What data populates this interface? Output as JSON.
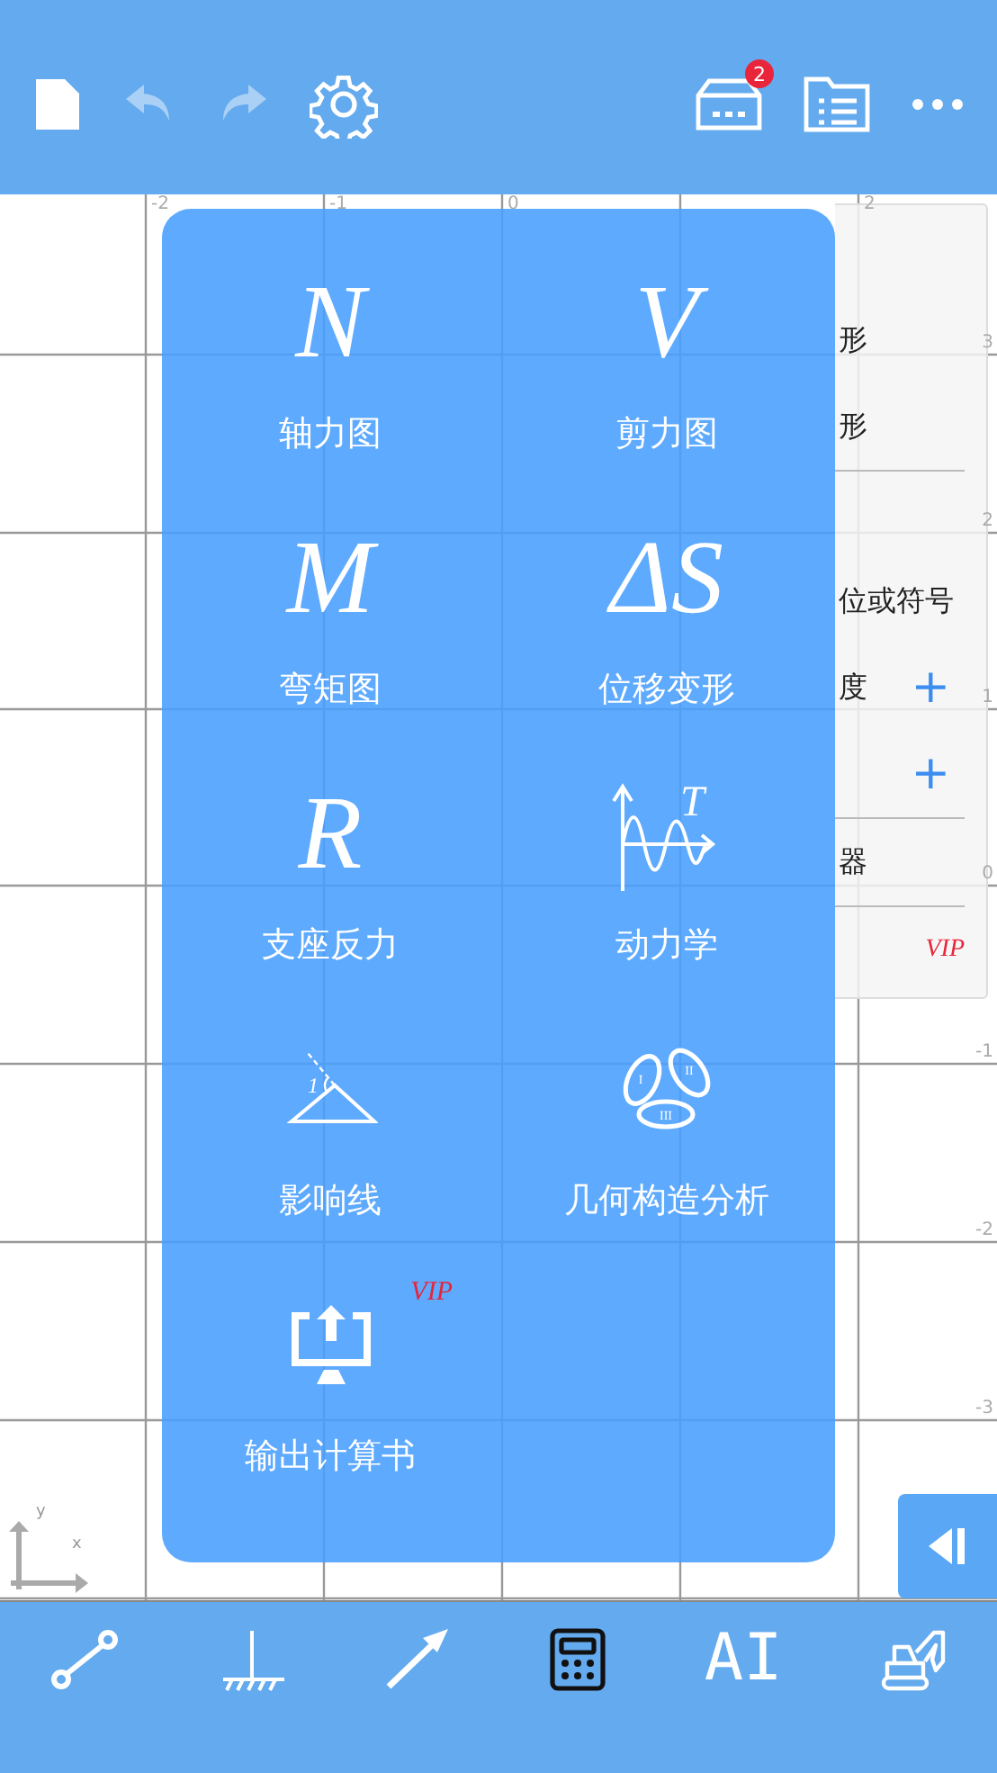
{
  "toolbar": {
    "left": [
      {
        "kind": "file",
        "disabled": false
      },
      {
        "kind": "undo",
        "disabled": true
      },
      {
        "kind": "redo",
        "disabled": true
      },
      {
        "kind": "settings",
        "disabled": false
      }
    ],
    "right": [
      {
        "kind": "inbox",
        "badge": "2"
      },
      {
        "kind": "list"
      },
      {
        "kind": "more"
      }
    ]
  },
  "canvas": {
    "x_labels": [
      "-2",
      "-1",
      "0",
      "2"
    ],
    "y_labels": [
      "3",
      "2",
      "1",
      "0",
      "-1",
      "-2",
      "-3"
    ],
    "axis_x": "x",
    "axis_y": "y"
  },
  "settings_panel": {
    "rows": [
      {
        "kind": "blank"
      },
      {
        "kind": "text",
        "label": "形"
      },
      {
        "kind": "text",
        "label": "形"
      },
      {
        "kind": "divider"
      },
      {
        "kind": "blank"
      },
      {
        "kind": "text",
        "label": "位或符号"
      },
      {
        "kind": "scale",
        "label": "度",
        "plus": "+"
      },
      {
        "kind": "stepper",
        "plus": "+"
      },
      {
        "kind": "divider"
      },
      {
        "kind": "text",
        "label": "器"
      },
      {
        "kind": "divider"
      },
      {
        "kind": "badge",
        "badge": "VIP"
      }
    ]
  },
  "analysis_menu": {
    "items": [
      {
        "kind": "letter",
        "symbol": "N",
        "label": "轴力图"
      },
      {
        "kind": "letter",
        "symbol": "V",
        "label": "剪力图"
      },
      {
        "kind": "letter",
        "symbol": "M",
        "label": "弯矩图"
      },
      {
        "kind": "letter",
        "symbol": "ΔS",
        "label": "位移变形"
      },
      {
        "kind": "letter",
        "symbol": "R",
        "label": "支座反力"
      },
      {
        "kind": "dynamic",
        "symbol": "T",
        "label": "动力学"
      },
      {
        "kind": "influence",
        "symbol": "1",
        "label": "影响线"
      },
      {
        "kind": "geometry",
        "marks": [
          "I",
          "II",
          "III"
        ],
        "label": "几何构造分析"
      },
      {
        "kind": "export",
        "label": "输出计算书",
        "badge": "VIP"
      }
    ]
  },
  "bottom_bar": [
    {
      "kind": "line",
      "selected": false
    },
    {
      "kind": "support",
      "selected": false
    },
    {
      "kind": "load",
      "selected": false
    },
    {
      "kind": "calculator",
      "selected": true
    },
    {
      "kind": "text",
      "text": "AI",
      "selected": false
    },
    {
      "kind": "excavator",
      "selected": false
    }
  ]
}
